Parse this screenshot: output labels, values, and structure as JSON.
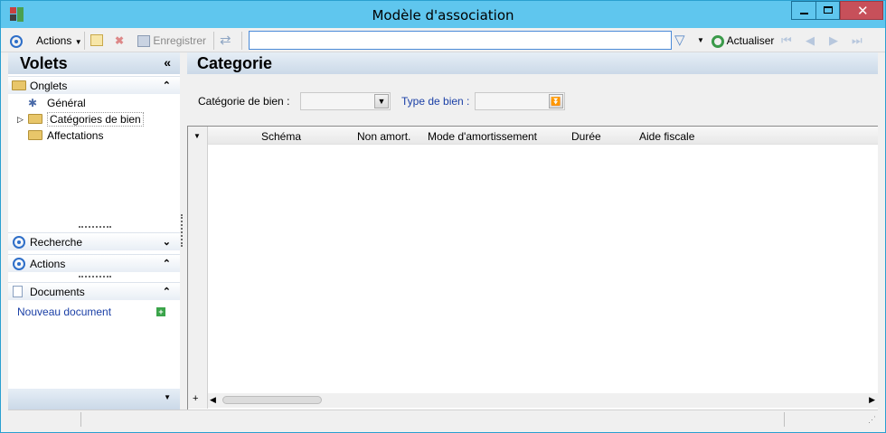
{
  "window": {
    "title": "Modèle d'association",
    "controls": {
      "minimize": "minimize-icon",
      "maximize": "maximize-icon",
      "close": "close-icon"
    }
  },
  "toolbar": {
    "actions_label": "Actions",
    "save_label": "Enregistrer",
    "refresh_label": "Actualiser",
    "search_value": "",
    "icons": [
      "target-icon",
      "new-document-icon",
      "delete-icon",
      "save-icon",
      "sync-icon",
      "filter-icon",
      "refresh-icon",
      "first-icon",
      "prev-icon",
      "next-icon",
      "last-icon"
    ]
  },
  "left_panel": {
    "title": "Volets",
    "onglets": {
      "label": "Onglets",
      "items": [
        "Général",
        "Catégories de bien",
        "Affectations"
      ]
    },
    "recherche_label": "Recherche",
    "actions_label": "Actions",
    "documents": {
      "label": "Documents",
      "new_document": "Nouveau document"
    }
  },
  "main": {
    "title": "Categorie",
    "filters": {
      "category_label": "Catégorie de bien :",
      "category_value": "",
      "type_label": "Type de bien :",
      "type_value": ""
    },
    "grid": {
      "columns": [
        "Schéma",
        "Non amort.",
        "Mode d'amortissement",
        "Durée",
        "Aide fiscale"
      ],
      "rows": []
    }
  },
  "colors": {
    "titlebar": "#5fc6ee",
    "close": "#c7505a",
    "link": "#1a3fa6",
    "accent": "#2d6ec8"
  }
}
